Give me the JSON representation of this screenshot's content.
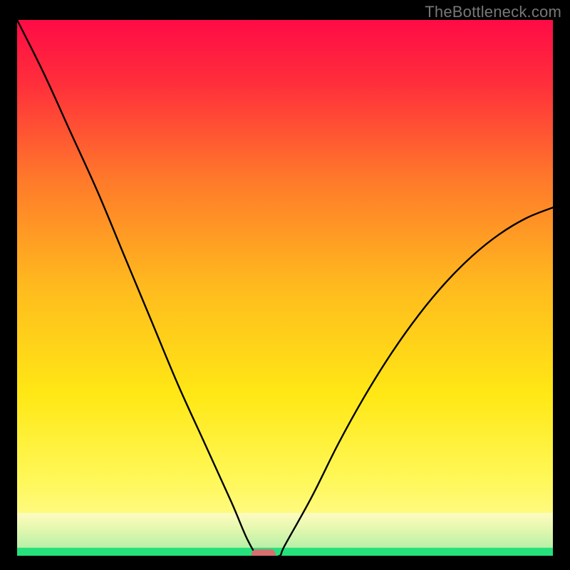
{
  "watermark": "TheBottleneck.com",
  "chart_data": {
    "type": "line",
    "title": "",
    "xlabel": "",
    "ylabel": "",
    "xlim": [
      0,
      100
    ],
    "ylim": [
      0,
      100
    ],
    "x": [
      0,
      5,
      10,
      15,
      20,
      25,
      30,
      35,
      40,
      43,
      45,
      47,
      49,
      50,
      55,
      60,
      65,
      70,
      75,
      80,
      85,
      90,
      95,
      100
    ],
    "values": [
      100,
      90,
      79,
      68,
      56,
      44,
      32,
      21,
      10,
      3,
      0,
      0,
      0,
      2,
      11,
      21,
      30,
      38,
      45,
      51,
      56,
      60,
      63,
      65
    ],
    "marker": {
      "x": 46,
      "y": 0
    },
    "green_band": {
      "y_min": 0,
      "y_max": 1.5
    },
    "pale_band": {
      "y_min": 1.5,
      "y_max": 8
    }
  }
}
